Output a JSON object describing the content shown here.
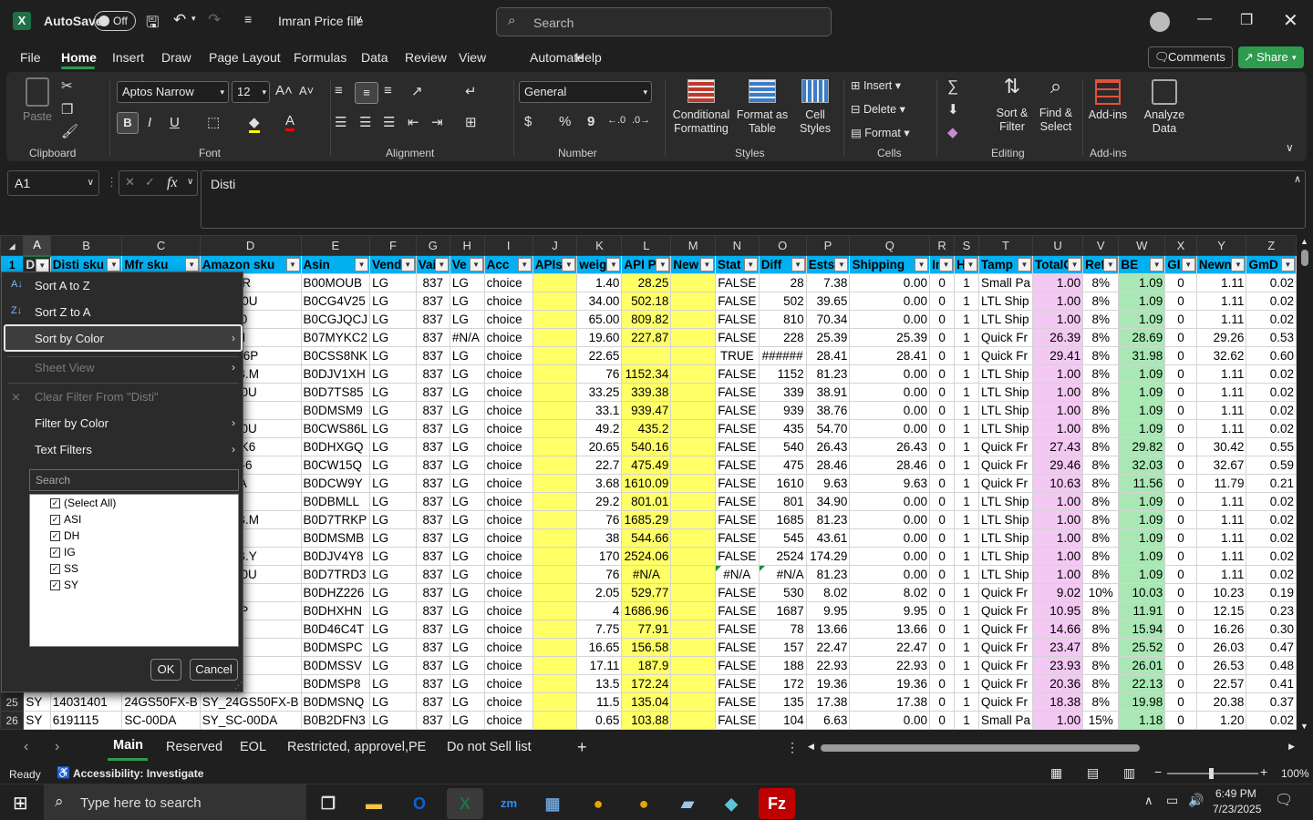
{
  "titlebar": {
    "autosave": "AutoSave",
    "toggle": "Off",
    "filename": "Imran Price file",
    "search_placeholder": "Search"
  },
  "menu": {
    "items": [
      "File",
      "Home",
      "Insert",
      "Draw",
      "Page Layout",
      "Formulas",
      "Data",
      "Review",
      "View",
      "Automate",
      "Help"
    ],
    "active": "Home",
    "comments": "Comments",
    "share": "Share"
  },
  "ribbon": {
    "clipboard": {
      "paste": "Paste",
      "label": "Clipboard"
    },
    "font": {
      "name": "Aptos Narrow",
      "size": "12",
      "label": "Font",
      "bold": "B",
      "italic": "I",
      "underline": "U"
    },
    "alignment": {
      "label": "Alignment"
    },
    "number": {
      "format": "General",
      "label": "Number",
      "currency": "$",
      "percent": "%",
      "comma": "9"
    },
    "styles": {
      "conditional": "Conditional Formatting",
      "format_table": "Format as Table",
      "cell_styles": "Cell Styles",
      "label": "Styles"
    },
    "cells": {
      "insert": "Insert",
      "delete": "Delete",
      "format": "Format",
      "label": "Cells"
    },
    "editing": {
      "sort": "Sort & Filter",
      "find": "Find & Select",
      "label": "Editing"
    },
    "addins": {
      "addins": "Add-ins",
      "analyze": "Analyze Data",
      "label": "Add-ins"
    }
  },
  "formula_bar": {
    "name_box": "A1",
    "fx": "fx",
    "value": "Disti"
  },
  "columns": [
    "A",
    "B",
    "C",
    "D",
    "E",
    "F",
    "G",
    "H",
    "I",
    "J",
    "K",
    "L",
    "M",
    "N",
    "O",
    "P",
    "Q",
    "R",
    "S",
    "T",
    "U",
    "V",
    "W",
    "X",
    "Y",
    "Z"
  ],
  "headers": [
    "D",
    "Disti sku",
    "Mfr sku",
    "Amazon sku",
    "Asin",
    "Vend",
    "Vai",
    "Ve",
    "Acc",
    "APIs",
    "weig",
    "API P",
    "New",
    "Stat",
    "Diff",
    "Ests",
    "Shipping",
    "In",
    "H",
    "Tamp",
    "TotalC",
    "Ref",
    "BE",
    "Gl",
    "Newn",
    "GmD"
  ],
  "rows": [
    {
      "n": "2",
      "c": [
        "",
        "",
        "",
        "4NSC0R",
        "B00MOUB",
        "LG",
        "837",
        "LG",
        "choice",
        "",
        "1.40",
        "28.25",
        "",
        "FALSE",
        "28",
        "7.38",
        "0.00",
        "0",
        "1",
        "Small Pa",
        "1.00",
        "8%",
        "1.09",
        "0",
        "1.11",
        "0.02"
      ]
    },
    {
      "n": "3",
      "c": [
        "",
        "",
        "",
        "M670H0U",
        "B0CG4V25",
        "LG",
        "837",
        "LG",
        "choice",
        "",
        "34.00",
        "502.18",
        "",
        "FALSE",
        "502",
        "39.65",
        "0.00",
        "0",
        "1",
        "LTL Ship",
        "1.00",
        "8%",
        "1.09",
        "0",
        "1.11",
        "0.02"
      ]
    },
    {
      "n": "4",
      "c": [
        "",
        "",
        "",
        "N343H0",
        "B0CGJQCJ",
        "LG",
        "837",
        "LG",
        "choice",
        "",
        "65.00",
        "809.82",
        "",
        "FALSE",
        "810",
        "70.34",
        "0.00",
        "0",
        "1",
        "LTL Ship",
        "1.00",
        "8%",
        "1.09",
        "0",
        "1.11",
        "0.02"
      ]
    },
    {
      "n": "5",
      "c": [
        "",
        "",
        "",
        "K550Y-I",
        "B07MYKC2",
        "LG",
        "837",
        "#N/A",
        "choice",
        "",
        "19.60",
        "227.87",
        "",
        "FALSE",
        "228",
        "25.39",
        "25.39",
        "0",
        "1",
        "Quick Fr",
        "26.39",
        "8%",
        "28.69",
        "0",
        "29.26",
        "0.53"
      ]
    },
    {
      "n": "6",
      "c": [
        "",
        "",
        "",
        "R670IK6P",
        "B0CSS8NK",
        "LG",
        "837",
        "LG",
        "choice",
        "",
        "22.65",
        "",
        "",
        "TRUE",
        "######",
        "28.41",
        "28.41",
        "0",
        "1",
        "Quick Fr",
        "29.41",
        "8%",
        "31.98",
        "0",
        "32.62",
        "0.60"
      ]
    },
    {
      "n": "7",
      "c": [
        "",
        "",
        "",
        "23DK-B.M",
        "B0DJV1XH",
        "LG",
        "837",
        "LG",
        "choice",
        "",
        "76",
        "1152.34",
        "",
        "FALSE",
        "1152",
        "81.23",
        "0.00",
        "0",
        "1",
        "LTL Ship",
        "1.00",
        "8%",
        "1.09",
        "0",
        "1.11",
        "0.02"
      ]
    },
    {
      "n": "8",
      "c": [
        "",
        "",
        "",
        "M340E0U",
        "B0D7TS85",
        "LG",
        "837",
        "LG",
        "choice",
        "",
        "33.25",
        "339.38",
        "",
        "FALSE",
        "339",
        "38.91",
        "0.00",
        "0",
        "1",
        "LTL Ship",
        "1.00",
        "8%",
        "1.09",
        "0",
        "1.11",
        "0.02"
      ]
    },
    {
      "n": "9",
      "c": [
        "",
        "",
        "",
        "M5N-E",
        "B0DMSM9",
        "LG",
        "837",
        "LG",
        "choice",
        "",
        "33.1",
        "939.47",
        "",
        "FALSE",
        "939",
        "38.76",
        "0.00",
        "0",
        "1",
        "LTL Ship",
        "1.00",
        "8%",
        "1.09",
        "0",
        "1.11",
        "0.02"
      ]
    },
    {
      "n": "10",
      "c": [
        "",
        "",
        "",
        "M340E0U",
        "B0CWS86L",
        "LG",
        "837",
        "LG",
        "choice",
        "",
        "49.2",
        "435.2",
        "",
        "FALSE",
        "435",
        "54.70",
        "0.00",
        "0",
        "1",
        "LTL Ship",
        "1.00",
        "8%",
        "1.09",
        "0",
        "1.11",
        "0.02"
      ]
    },
    {
      "n": "11",
      "c": [
        "",
        "",
        "",
        "R660NK6",
        "B0DHXGQ",
        "LG",
        "837",
        "LG",
        "choice",
        "",
        "20.65",
        "540.16",
        "",
        "FALSE",
        "540",
        "26.43",
        "26.43",
        "0",
        "1",
        "Quick Fr",
        "27.43",
        "8%",
        "29.82",
        "0",
        "30.42",
        "0.55"
      ]
    },
    {
      "n": "12",
      "c": [
        "",
        "",
        "",
        "Q650N-6",
        "B0CW15Q",
        "LG",
        "837",
        "LG",
        "choice",
        "",
        "22.7",
        "475.49",
        "",
        "FALSE",
        "475",
        "28.46",
        "28.46",
        "0",
        "1",
        "Quick Fr",
        "29.46",
        "8%",
        "32.03",
        "0",
        "32.67",
        "0.59"
      ]
    },
    {
      "n": "13",
      "c": [
        "",
        "",
        "",
        "0ST-V.A",
        "B0DCW9Y",
        "LG",
        "837",
        "LG",
        "choice",
        "",
        "3.68",
        "1610.09",
        "",
        "FALSE",
        "1610",
        "9.63",
        "9.63",
        "0",
        "1",
        "Quick Fr",
        "10.63",
        "8%",
        "11.56",
        "0",
        "11.79",
        "0.21"
      ]
    },
    {
      "n": "14",
      "c": [
        "",
        "",
        "",
        "H7N-E",
        "B0DBMLL",
        "LG",
        "837",
        "LG",
        "choice",
        "",
        "29.2",
        "801.01",
        "",
        "FALSE",
        "801",
        "34.90",
        "0.00",
        "0",
        "1",
        "LTL Ship",
        "1.00",
        "8%",
        "1.09",
        "0",
        "1.11",
        "0.02"
      ]
    },
    {
      "n": "15",
      "c": [
        "",
        "",
        "",
        "23DK-B.M",
        "B0D7TRKP",
        "LG",
        "837",
        "LG",
        "choice",
        "",
        "76",
        "1685.29",
        "",
        "FALSE",
        "1685",
        "81.23",
        "0.00",
        "0",
        "1",
        "LTL Ship",
        "1.00",
        "8%",
        "1.09",
        "0",
        "1.11",
        "0.02"
      ]
    },
    {
      "n": "16",
      "c": [
        "",
        "",
        "",
        "M5N-E",
        "B0DMSMB",
        "LG",
        "837",
        "LG",
        "choice",
        "",
        "38",
        "544.66",
        "",
        "FALSE",
        "545",
        "43.61",
        "0.00",
        "0",
        "1",
        "LTL Ship",
        "1.00",
        "8%",
        "1.09",
        "0",
        "1.11",
        "0.02"
      ]
    },
    {
      "n": "17",
      "c": [
        "",
        "",
        "",
        "23DK-B.Y",
        "B0DJV4Y8",
        "LG",
        "837",
        "LG",
        "choice",
        "",
        "170",
        "2524.06",
        "",
        "FALSE",
        "2524",
        "174.29",
        "0.00",
        "0",
        "1",
        "LTL Ship",
        "1.00",
        "8%",
        "1.09",
        "0",
        "1.11",
        "0.02"
      ]
    },
    {
      "n": "18",
      "c": [
        "",
        "",
        "",
        "M340E0U",
        "B0D7TRD3",
        "LG",
        "837",
        "LG",
        "choice",
        "",
        "76",
        "#N/A",
        "",
        "#N/A",
        "#N/A",
        "81.23",
        "0.00",
        "0",
        "1",
        "LTL Ship",
        "1.00",
        "8%",
        "1.09",
        "0",
        "1.11",
        "0.02"
      ]
    },
    {
      "n": "19",
      "c": [
        "",
        "",
        "",
        "-C001",
        "B0DHZ226",
        "LG",
        "837",
        "LG",
        "choice",
        "",
        "2.05",
        "529.77",
        "",
        "FALSE",
        "530",
        "8.02",
        "8.02",
        "0",
        "1",
        "Quick Fr",
        "9.02",
        "10%",
        "10.03",
        "0",
        "10.23",
        "0.19"
      ]
    },
    {
      "n": "20",
      "c": [
        "",
        "",
        "",
        "0S-V.AP",
        "B0DHXHN",
        "LG",
        "837",
        "LG",
        "choice",
        "",
        "4",
        "1686.96",
        "",
        "FALSE",
        "1687",
        "9.95",
        "9.95",
        "0",
        "1",
        "Quick Fr",
        "10.95",
        "8%",
        "11.91",
        "0",
        "12.15",
        "0.23"
      ]
    },
    {
      "n": "21",
      "c": [
        "",
        "",
        "",
        "R410-B",
        "B0D46C4T",
        "LG",
        "837",
        "LG",
        "choice",
        "",
        "7.75",
        "77.91",
        "",
        "FALSE",
        "78",
        "13.66",
        "13.66",
        "0",
        "1",
        "Quick Fr",
        "14.66",
        "8%",
        "15.94",
        "0",
        "16.26",
        "0.30"
      ]
    },
    {
      "n": "22",
      "c": [
        "",
        "",
        "",
        "A450-B",
        "B0DMSPC",
        "LG",
        "837",
        "LG",
        "choice",
        "",
        "16.65",
        "156.58",
        "",
        "FALSE",
        "157",
        "22.47",
        "22.47",
        "0",
        "1",
        "Quick Fr",
        "23.47",
        "8%",
        "25.52",
        "0",
        "26.03",
        "0.47"
      ]
    },
    {
      "n": "23",
      "c": [
        "",
        "",
        "",
        "A550-B",
        "B0DMSSV",
        "LG",
        "837",
        "LG",
        "choice",
        "",
        "17.11",
        "187.9",
        "",
        "FALSE",
        "188",
        "22.93",
        "22.93",
        "0",
        "1",
        "Quick Fr",
        "23.93",
        "8%",
        "26.01",
        "0",
        "26.53",
        "0.48"
      ]
    },
    {
      "n": "24",
      "c": [
        "",
        "",
        "",
        "A560-B",
        "B0DMSP8",
        "LG",
        "837",
        "LG",
        "choice",
        "",
        "13.5",
        "172.24",
        "",
        "FALSE",
        "172",
        "19.36",
        "19.36",
        "0",
        "1",
        "Quick Fr",
        "20.36",
        "8%",
        "22.13",
        "0",
        "22.57",
        "0.41"
      ]
    },
    {
      "n": "25",
      "c": [
        "SY",
        "14031401",
        "24GS50FX-B",
        "SY_24GS50FX-B",
        "B0DMSNQ",
        "LG",
        "837",
        "LG",
        "choice",
        "",
        "11.5",
        "135.04",
        "",
        "FALSE",
        "135",
        "17.38",
        "17.38",
        "0",
        "1",
        "Quick Fr",
        "18.38",
        "8%",
        "19.98",
        "0",
        "20.38",
        "0.37"
      ]
    },
    {
      "n": "26",
      "c": [
        "SY",
        "6191115",
        "SC-00DA",
        "SY_SC-00DA",
        "B0B2DFN3",
        "LG",
        "837",
        "LG",
        "choice",
        "",
        "0.65",
        "103.88",
        "",
        "FALSE",
        "104",
        "6.63",
        "0.00",
        "0",
        "1",
        "Small Pa",
        "1.00",
        "15%",
        "1.18",
        "0",
        "1.20",
        "0.02"
      ]
    }
  ],
  "filter_menu": {
    "sort_az": "Sort A to Z",
    "sort_za": "Sort Z to A",
    "sort_color": "Sort by Color",
    "sheet_view": "Sheet View",
    "clear_filter": "Clear Filter From \"Disti\"",
    "filter_color": "Filter by Color",
    "text_filters": "Text Filters",
    "search_placeholder": "Search",
    "values": [
      "(Select All)",
      "ASI",
      "DH",
      "IG",
      "SS",
      "SY"
    ],
    "ok": "OK",
    "cancel": "Cancel"
  },
  "sheets": {
    "tabs": [
      "Main",
      "Reserved",
      "EOL",
      "Restricted, approvel,PE",
      "Do not Sell list"
    ],
    "active": "Main"
  },
  "status": {
    "ready": "Ready",
    "accessibility": "Accessibility: Investigate",
    "zoom": "100%"
  },
  "taskbar": {
    "search_placeholder": "Type here to search",
    "time": "6:49 PM",
    "date": "7/23/2025"
  },
  "colors": {
    "accent_green": "#1e7145",
    "header_blue": "#00b0f0",
    "yellow": "#ffff66",
    "pink": "#f3c8f3",
    "green_cell": "#a9e8b4",
    "share": "#2e9b4e"
  }
}
